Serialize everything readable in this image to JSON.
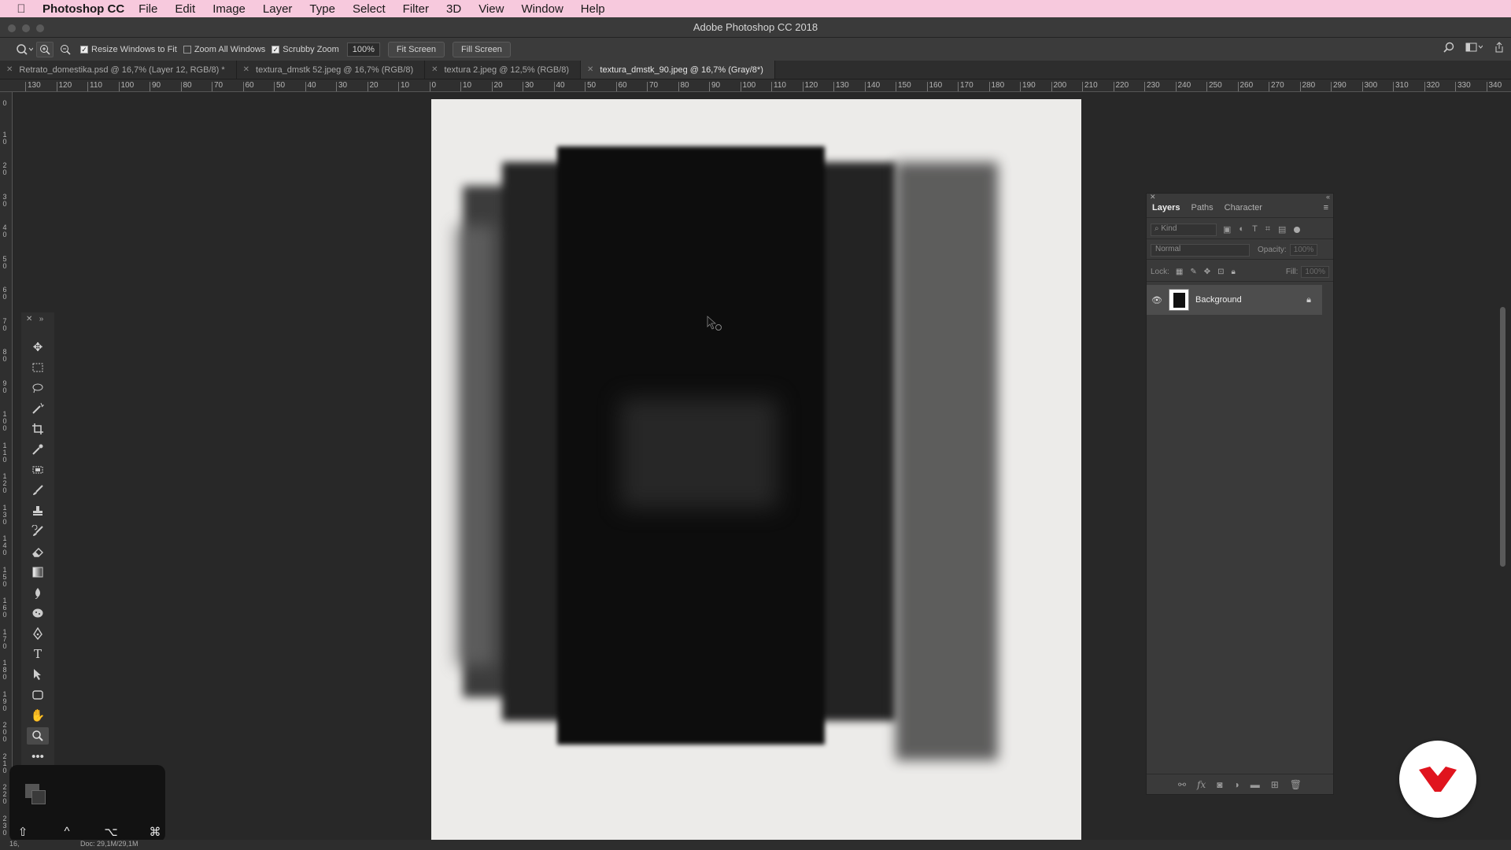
{
  "menubar": {
    "app_name": "Photoshop CC",
    "items": [
      "File",
      "Edit",
      "Image",
      "Layer",
      "Type",
      "Select",
      "Filter",
      "3D",
      "View",
      "Window",
      "Help"
    ]
  },
  "window": {
    "title": "Adobe Photoshop CC 2018"
  },
  "options": {
    "resize_label": "Resize Windows to Fit",
    "zoom_all_label": "Zoom All Windows",
    "scrubby_label": "Scrubby Zoom",
    "zoom_value": "100%",
    "fit_screen": "Fit Screen",
    "fill_screen": "Fill Screen"
  },
  "tabs": [
    {
      "label": "Retrato_domestika.psd @ 16,7% (Layer 12, RGB/8) *"
    },
    {
      "label": "textura_dmstk 52.jpeg @ 16,7% (RGB/8)"
    },
    {
      "label": "textura 2.jpeg @ 12,5% (RGB/8)"
    },
    {
      "label": "textura_dmstk_90.jpeg @ 16,7% (Gray/8*)"
    }
  ],
  "ruler": {
    "h_ticks": [
      "130",
      "120",
      "110",
      "100",
      "90",
      "80",
      "70",
      "60",
      "50",
      "40",
      "30",
      "20",
      "10",
      "0",
      "10",
      "20",
      "30",
      "40",
      "50",
      "60",
      "70",
      "80",
      "90",
      "100",
      "110",
      "120",
      "130",
      "140",
      "150",
      "160",
      "170",
      "180",
      "190",
      "200",
      "210",
      "220",
      "230",
      "240",
      "250",
      "260",
      "270",
      "280",
      "290",
      "300",
      "310",
      "320",
      "330",
      "340"
    ],
    "v_ticks": [
      "0",
      "1 0",
      "2 0",
      "3 0",
      "4 0",
      "5 0",
      "6 0",
      "7 0",
      "8 0",
      "9 0",
      "1 0 0",
      "1 1 0",
      "1 2 0",
      "1 3 0",
      "1 4 0",
      "1 5 0",
      "1 6 0",
      "1 7 0",
      "1 8 0",
      "1 9 0",
      "2 0 0",
      "2 1 0",
      "2 2 0",
      "2 3 0"
    ]
  },
  "layers_panel": {
    "tabs": [
      "Layers",
      "Paths",
      "Character"
    ],
    "kind_placeholder": "Kind",
    "blend_mode": "Normal",
    "opacity_label": "Opacity:",
    "opacity_value": "100%",
    "lock_label": "Lock:",
    "fill_label": "Fill:",
    "fill_value": "100%",
    "layer_name": "Background"
  },
  "status": {
    "zoom": "16,",
    "doc_info": "Doc: 29,1M/29,1M"
  },
  "touchbar": {
    "keys": [
      "⇧",
      "^",
      "⌥",
      "⌘"
    ]
  },
  "colors": {
    "menubar_bg": "#f7c9dd",
    "logo_red": "#e0141e",
    "panel_bg": "#3a3a3a",
    "canvas_bg": "#282828"
  }
}
